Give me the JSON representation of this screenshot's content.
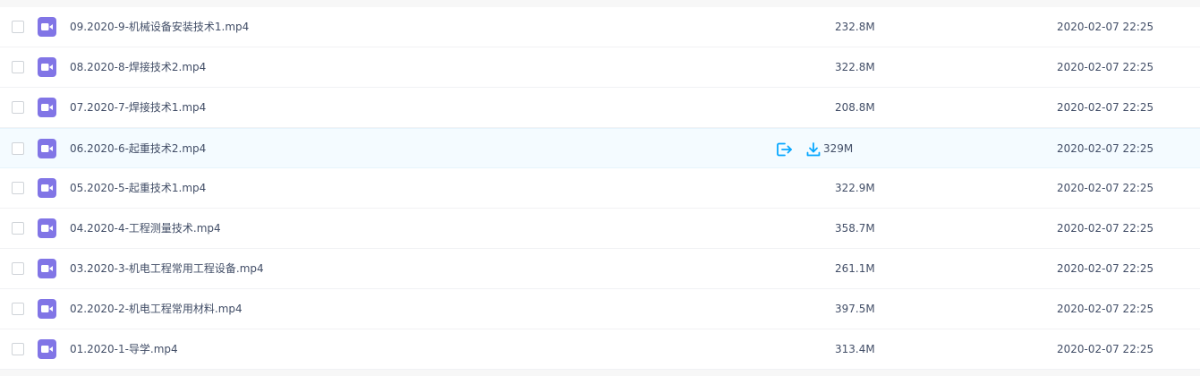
{
  "files": [
    {
      "name": "09.2020-9-机械设备安装技术1.mp4",
      "size": "232.8M",
      "date": "2020-02-07 22:25",
      "icon": "video-file-icon"
    },
    {
      "name": "08.2020-8-焊接技术2.mp4",
      "size": "322.8M",
      "date": "2020-02-07 22:25",
      "icon": "video-file-icon"
    },
    {
      "name": "07.2020-7-焊接技术1.mp4",
      "size": "208.8M",
      "date": "2020-02-07 22:25",
      "icon": "video-file-icon"
    },
    {
      "name": "06.2020-6-起重技术2.mp4",
      "size": "329M",
      "date": "2020-02-07 22:25",
      "icon": "video-file-icon",
      "hovered": true
    },
    {
      "name": "05.2020-5-起重技术1.mp4",
      "size": "322.9M",
      "date": "2020-02-07 22:25",
      "icon": "video-file-icon"
    },
    {
      "name": "04.2020-4-工程测量技术.mp4",
      "size": "358.7M",
      "date": "2020-02-07 22:25",
      "icon": "video-file-icon"
    },
    {
      "name": "03.2020-3-机电工程常用工程设备.mp4",
      "size": "261.1M",
      "date": "2020-02-07 22:25",
      "icon": "video-file-icon"
    },
    {
      "name": "02.2020-2-机电工程常用材料.mp4",
      "size": "397.5M",
      "date": "2020-02-07 22:25",
      "icon": "video-file-icon"
    },
    {
      "name": "01.2020-1-导学.mp4",
      "size": "313.4M",
      "date": "2020-02-07 22:25",
      "icon": "video-file-icon"
    }
  ],
  "row_actions": {
    "share_icon": "share-icon",
    "download_icon": "download-icon"
  },
  "colors": {
    "video_icon": "#8175e6",
    "action_icon": "#06a7ff",
    "row_hover_bg": "#f4fbff",
    "text": "#424e67"
  }
}
